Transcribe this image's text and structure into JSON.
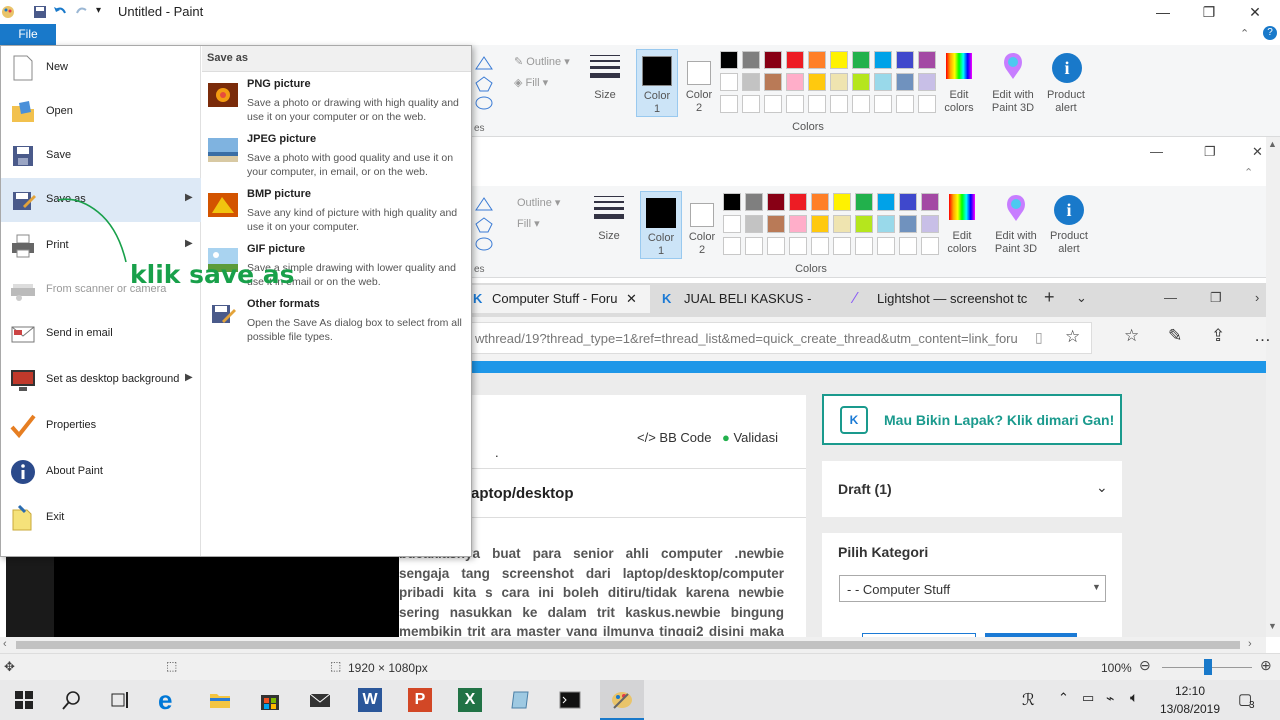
{
  "window": {
    "title": "Untitled - Paint"
  },
  "ribbon": {
    "shapes_outline": "Outline",
    "shapes_fill": "Fill",
    "shapes_group": "es",
    "size": "Size",
    "color1": [
      "Color",
      "1"
    ],
    "color2": [
      "Color",
      "2"
    ],
    "edit_colors": [
      "Edit",
      "colors"
    ],
    "paint3d": [
      "Edit with",
      "Paint 3D"
    ],
    "product_alert": [
      "Product",
      "alert"
    ],
    "colors_group": "Colors",
    "accent": "#1979ca",
    "palette_row1": [
      "#000000",
      "#7f7f7f",
      "#880015",
      "#ed1c24",
      "#ff7f27",
      "#fff200",
      "#22b14c",
      "#00a2e8",
      "#3f48cc",
      "#a349a4"
    ],
    "palette_row2": [
      "#ffffff",
      "#c3c3c3",
      "#b97a57",
      "#ffaec9",
      "#ffc90e",
      "#efe4b0",
      "#b5e61d",
      "#99d9ea",
      "#7092be",
      "#c8bfe7"
    ]
  },
  "file_menu": {
    "tab_label": "File",
    "items": [
      {
        "label": "New",
        "icon": "new-document-icon"
      },
      {
        "label": "Open",
        "icon": "open-folder-icon"
      },
      {
        "label": "Save",
        "icon": "save-disk-icon"
      },
      {
        "label": "Save as",
        "icon": "save-as-icon"
      },
      {
        "label": "Print",
        "icon": "printer-icon"
      },
      {
        "label": "From scanner or camera",
        "icon": "scanner-icon"
      },
      {
        "label": "Send in email",
        "icon": "email-icon"
      },
      {
        "label": "Set as desktop background",
        "icon": "desktop-background-icon"
      },
      {
        "label": "Properties",
        "icon": "properties-checkmark-icon"
      },
      {
        "label": "About Paint",
        "icon": "info-icon"
      },
      {
        "label": "Exit",
        "icon": "exit-icon"
      }
    ],
    "annotation": "klik save as",
    "submenu": {
      "title": "Save as",
      "items": [
        {
          "title": "PNG picture",
          "desc": "Save a photo or drawing with high quality and use it on your computer or on the web."
        },
        {
          "title": "JPEG picture",
          "desc": "Save a photo with good quality and use it on your computer, in email, or on the web."
        },
        {
          "title": "BMP picture",
          "desc": "Save any kind of picture with high quality and use it on your computer."
        },
        {
          "title": "GIF picture",
          "desc": "Save a simple drawing with lower quality and use it in email or on the web."
        },
        {
          "title": "Other formats",
          "desc": "Open the Save As dialog box to select from all possible file types."
        }
      ]
    }
  },
  "browser": {
    "tabs": [
      "Computer Stuff - Foru",
      "JUAL BELI KASKUS - Pusat",
      "Lightshot — screenshot tc"
    ],
    "url": "wthread/19?thread_type=1&ref=thread_list&med=quick_create_thread&utm_content=link_foru",
    "toolbar_bb": "BB Code",
    "toolbar_valid": "Validasi",
    "dot": ".",
    "heading_fragment": "aptop/desktop",
    "body_text": "bucaklasnya buat para senior ahli computer .newbie sengaja tang screenshot dari laptop/desktop/computer pribadi kita s cara ini boleh ditiru/tidak karena newbie sering nasukkan ke dalam trit kaskus.newbie bingung membikin trit ara master yang ilmunya tinggi2 disini maka newbie dengan",
    "lapak_banner": "Mau Bikin Lapak? Klik dimari Gan!",
    "draft": "Draft (1)",
    "pilih_kategori": "Pilih Kategori",
    "kategori_value": "- - Computer Stuff"
  },
  "status_bar": {
    "dimensions": "1920 × 1080px",
    "zoom": "100%"
  },
  "taskbar": {
    "time": "12:10",
    "date": "13/08/2019",
    "notifications": "3"
  }
}
